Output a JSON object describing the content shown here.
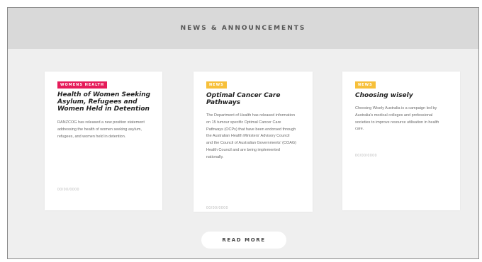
{
  "section": {
    "title": "NEWS & ANNOUNCEMENTS"
  },
  "cards": [
    {
      "tag": "WOMENS HEALTH",
      "tag_color": "#e51c5a",
      "title": "Health of Women Seeking Asylum, Refugees and Women Held in Detention",
      "body": "RANZCOG has released a new position statement addressing the health of women seeking asylum, refugees, and women held in detention.",
      "date": "00/00/0000"
    },
    {
      "tag": "NEWS",
      "tag_color": "#f7c03a",
      "title": "Optimal Cancer Care Pathways",
      "body": "The Department of Health has released information on 15 tumour specific Optimal Cancer Care Pathways (OCPs) that have been endorsed through the Australian Health Ministers' Advisory Council and the Council of Australian Governments' (COAG) Health Council and are being implemented nationally.",
      "date": "00/00/0000"
    },
    {
      "tag": "NEWS",
      "tag_color": "#f7c03a",
      "title": "Choosing wisely",
      "body": "Choosing Wisely Australia is a campaign led by Australia's medical colleges and professional societies to improve resource utilisation in health care.",
      "date": "00/00/0000"
    }
  ],
  "read_more": {
    "label": "READ MORE"
  }
}
